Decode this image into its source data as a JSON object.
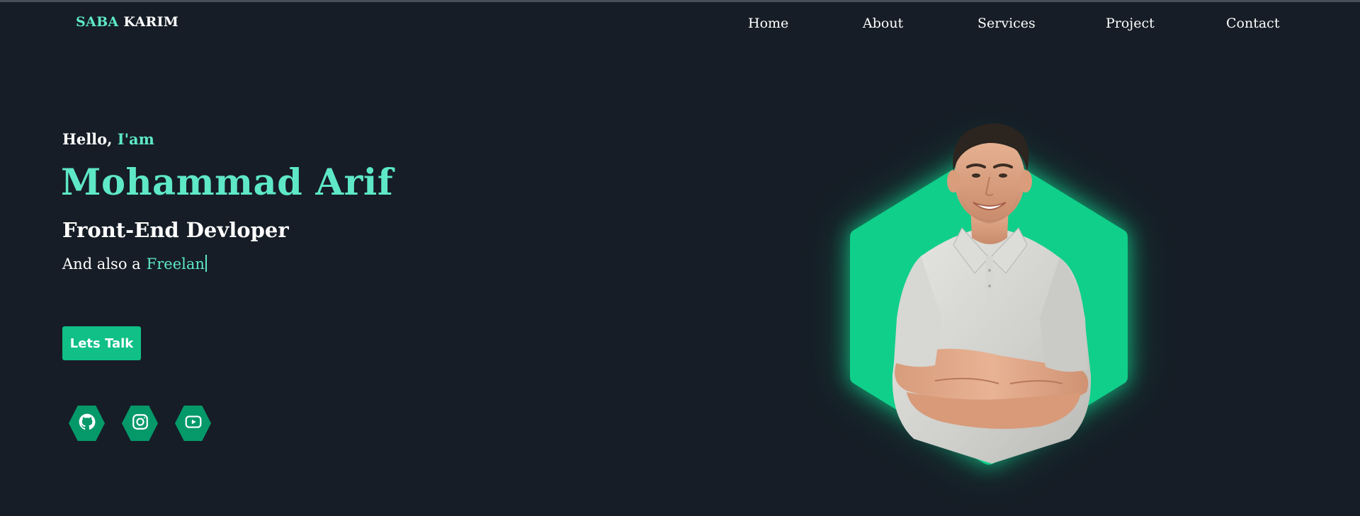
{
  "logo": {
    "first": "SABA",
    "last": "KARIM"
  },
  "nav": {
    "items": [
      {
        "label": "Home"
      },
      {
        "label": "About"
      },
      {
        "label": "Services"
      },
      {
        "label": "Project"
      },
      {
        "label": "Contact"
      }
    ]
  },
  "hero": {
    "greeting_prefix": "Hello,",
    "greeting_accent": "I'am",
    "name": "Mohammad Arif",
    "role": "Front-End Devloper",
    "also_prefix": "And also a",
    "typed_text": "Freelan",
    "cta_label": "Lets Talk"
  },
  "social": [
    {
      "icon": "github-icon"
    },
    {
      "icon": "instagram-icon"
    },
    {
      "icon": "youtube-icon"
    }
  ],
  "colors": {
    "background": "#161d26",
    "accent": "#5ee8c8",
    "button": "#10c086",
    "social_bg": "#05996a",
    "hexagon": "#10cf8a"
  }
}
